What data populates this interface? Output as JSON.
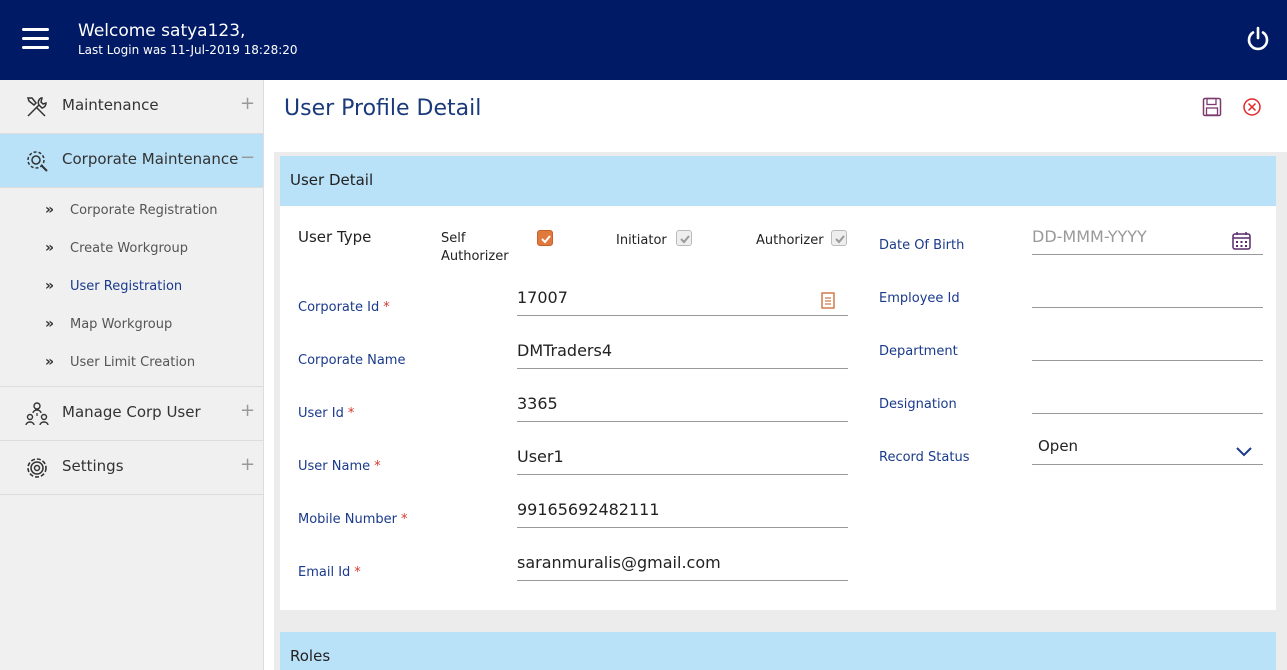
{
  "header": {
    "welcome": "Welcome satya123,",
    "last_login": "Last Login was 11-Jul-2019 18:28:20"
  },
  "sidebar": {
    "items": [
      {
        "label": "Maintenance",
        "icon": "tools-icon",
        "toggle": "+"
      },
      {
        "label": "Corporate Maintenance",
        "icon": "gear-search-icon",
        "toggle": "−",
        "active": true
      },
      {
        "label": "Manage Corp User",
        "icon": "org-users-icon",
        "toggle": "+"
      },
      {
        "label": "Settings",
        "icon": "gear-icon",
        "toggle": "+"
      }
    ],
    "sub_items": [
      {
        "label": "Corporate Registration"
      },
      {
        "label": "Create Workgroup"
      },
      {
        "label": "User Registration",
        "current": true
      },
      {
        "label": "Map Workgroup"
      },
      {
        "label": "User Limit Creation"
      }
    ],
    "chevron": "»"
  },
  "main": {
    "title": "User Profile Detail",
    "user_detail_title": "User Detail",
    "roles_title": "Roles",
    "user_type_label": "User Type",
    "checkboxes": {
      "self_authorizer_label": "Self\nAuthorizer",
      "initiator_label": "Initiator",
      "authorizer_label": "Authorizer"
    },
    "fields": {
      "corporate_id": {
        "label": "Corporate Id",
        "value": "17007",
        "required": "*"
      },
      "corporate_name": {
        "label": "Corporate Name",
        "value": "DMTraders4"
      },
      "user_id": {
        "label": "User Id",
        "value": "3365",
        "required": "*"
      },
      "user_name": {
        "label": "User Name",
        "value": "User1",
        "required": "*"
      },
      "mobile_number": {
        "label": "Mobile Number",
        "value": "99165692482111",
        "required": "*"
      },
      "email_id": {
        "label": "Email Id",
        "value": "saranmuralis@gmail.com",
        "required": "*"
      },
      "date_of_birth": {
        "label": "Date Of Birth",
        "placeholder": "DD-MMM-YYYY"
      },
      "employee_id": {
        "label": "Employee Id",
        "value": ""
      },
      "department": {
        "label": "Department",
        "value": ""
      },
      "designation": {
        "label": "Designation",
        "value": ""
      },
      "record_status": {
        "label": "Record Status",
        "value": "Open"
      }
    }
  },
  "colors": {
    "header_bg": "#001a66",
    "accent_blue": "#1a3a8c",
    "section_bg": "#b9e1f7",
    "required": "#d9362b",
    "checkbox_on": "#e07a3c"
  }
}
